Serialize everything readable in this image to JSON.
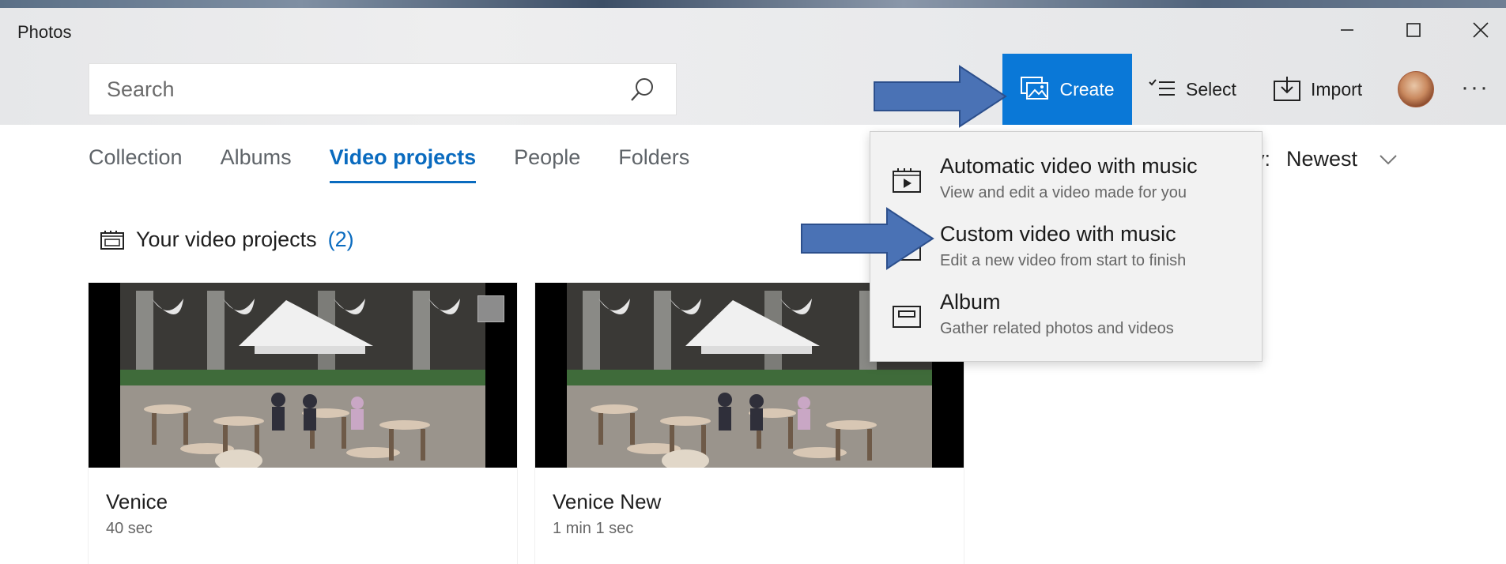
{
  "window": {
    "title": "Photos"
  },
  "search": {
    "placeholder": "Search"
  },
  "toolbar": {
    "create_label": "Create",
    "select_label": "Select",
    "import_label": "Import",
    "more_label": "···"
  },
  "tabs": [
    {
      "label": "Collection",
      "active": false
    },
    {
      "label": "Albums",
      "active": false
    },
    {
      "label": "Video projects",
      "active": true
    },
    {
      "label": "People",
      "active": false
    },
    {
      "label": "Folders",
      "active": false
    }
  ],
  "sort": {
    "prefix": "y:",
    "value": "Newest"
  },
  "section": {
    "title": "Your video projects",
    "count": "(2)"
  },
  "projects": [
    {
      "name": "Venice",
      "duration": "40 sec"
    },
    {
      "name": "Venice New",
      "duration": "1 min 1 sec"
    }
  ],
  "create_menu": {
    "items": [
      {
        "title": "Automatic video with music",
        "subtitle": "View and edit a video made for you",
        "icon": "auto-video-icon"
      },
      {
        "title": "Custom video with music",
        "subtitle": "Edit a new video from start to finish",
        "icon": "custom-video-icon"
      },
      {
        "title": "Album",
        "subtitle": "Gather related photos and videos",
        "icon": "album-icon"
      }
    ]
  },
  "colors": {
    "accent": "#0a78d7",
    "arrow": "#4a72b5"
  }
}
